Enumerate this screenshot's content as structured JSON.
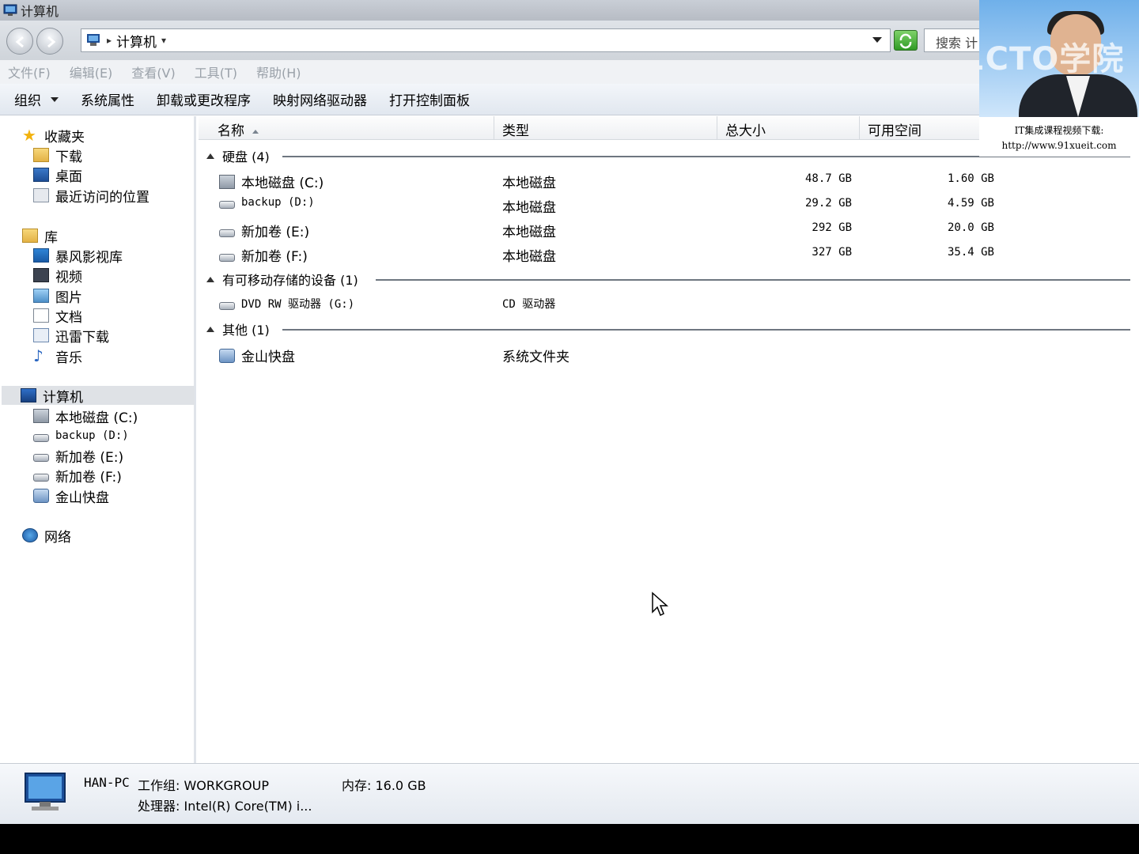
{
  "window": {
    "title": "计算机"
  },
  "address": {
    "crumb": "计算机",
    "search_placeholder": "搜索 计"
  },
  "menu": [
    "文件(F)",
    "编辑(E)",
    "查看(V)",
    "工具(T)",
    "帮助(H)"
  ],
  "commands": {
    "organize": "组织",
    "system_props": "系统属性",
    "uninstall": "卸载或更改程序",
    "map_drive": "映射网络驱动器",
    "control_panel": "打开控制面板"
  },
  "nav": {
    "favorites": "收藏夹",
    "downloads": "下载",
    "desktop": "桌面",
    "recent": "最近访问的位置",
    "libraries": "库",
    "storm": "暴风影视库",
    "videos": "视频",
    "pictures": "图片",
    "documents": "文档",
    "thunder": "迅雷下载",
    "music": "音乐",
    "computer": "计算机",
    "c_drive": "本地磁盘 (C:)",
    "d_drive": "backup (D:)",
    "e_drive": "新加卷 (E:)",
    "f_drive": "新加卷 (F:)",
    "kdisk": "金山快盘",
    "network": "网络"
  },
  "columns": {
    "name": "名称",
    "type": "类型",
    "total": "总大小",
    "free": "可用空间"
  },
  "groups": {
    "hdd": "硬盘 (4)",
    "removable": "有可移动存储的设备 (1)",
    "other": "其他 (1)"
  },
  "drives": [
    {
      "name": "本地磁盘 (C:)",
      "type": "本地磁盘",
      "total": "48.7 GB",
      "free": "1.60 GB"
    },
    {
      "name": "backup (D:)",
      "type": "本地磁盘",
      "total": "29.2 GB",
      "free": "4.59 GB"
    },
    {
      "name": "新加卷 (E:)",
      "type": "本地磁盘",
      "total": "292 GB",
      "free": "20.0 GB"
    },
    {
      "name": "新加卷 (F:)",
      "type": "本地磁盘",
      "total": "327 GB",
      "free": "35.4 GB"
    }
  ],
  "removable": [
    {
      "name": "DVD RW 驱动器 (G:)",
      "type": "CD 驱动器"
    }
  ],
  "other": [
    {
      "name": "金山快盘",
      "type": "系统文件夹"
    }
  ],
  "details": {
    "pc_name": "HAN-PC",
    "workgroup": "工作组: WORKGROUP",
    "memory": "内存: 16.0 GB",
    "cpu": "处理器: Intel(R) Core(TM) i..."
  },
  "overlay": {
    "logo": "51CTO学院",
    "line1": "IT集成课程视频下载:",
    "line2": "http://www.91xueit.com"
  }
}
